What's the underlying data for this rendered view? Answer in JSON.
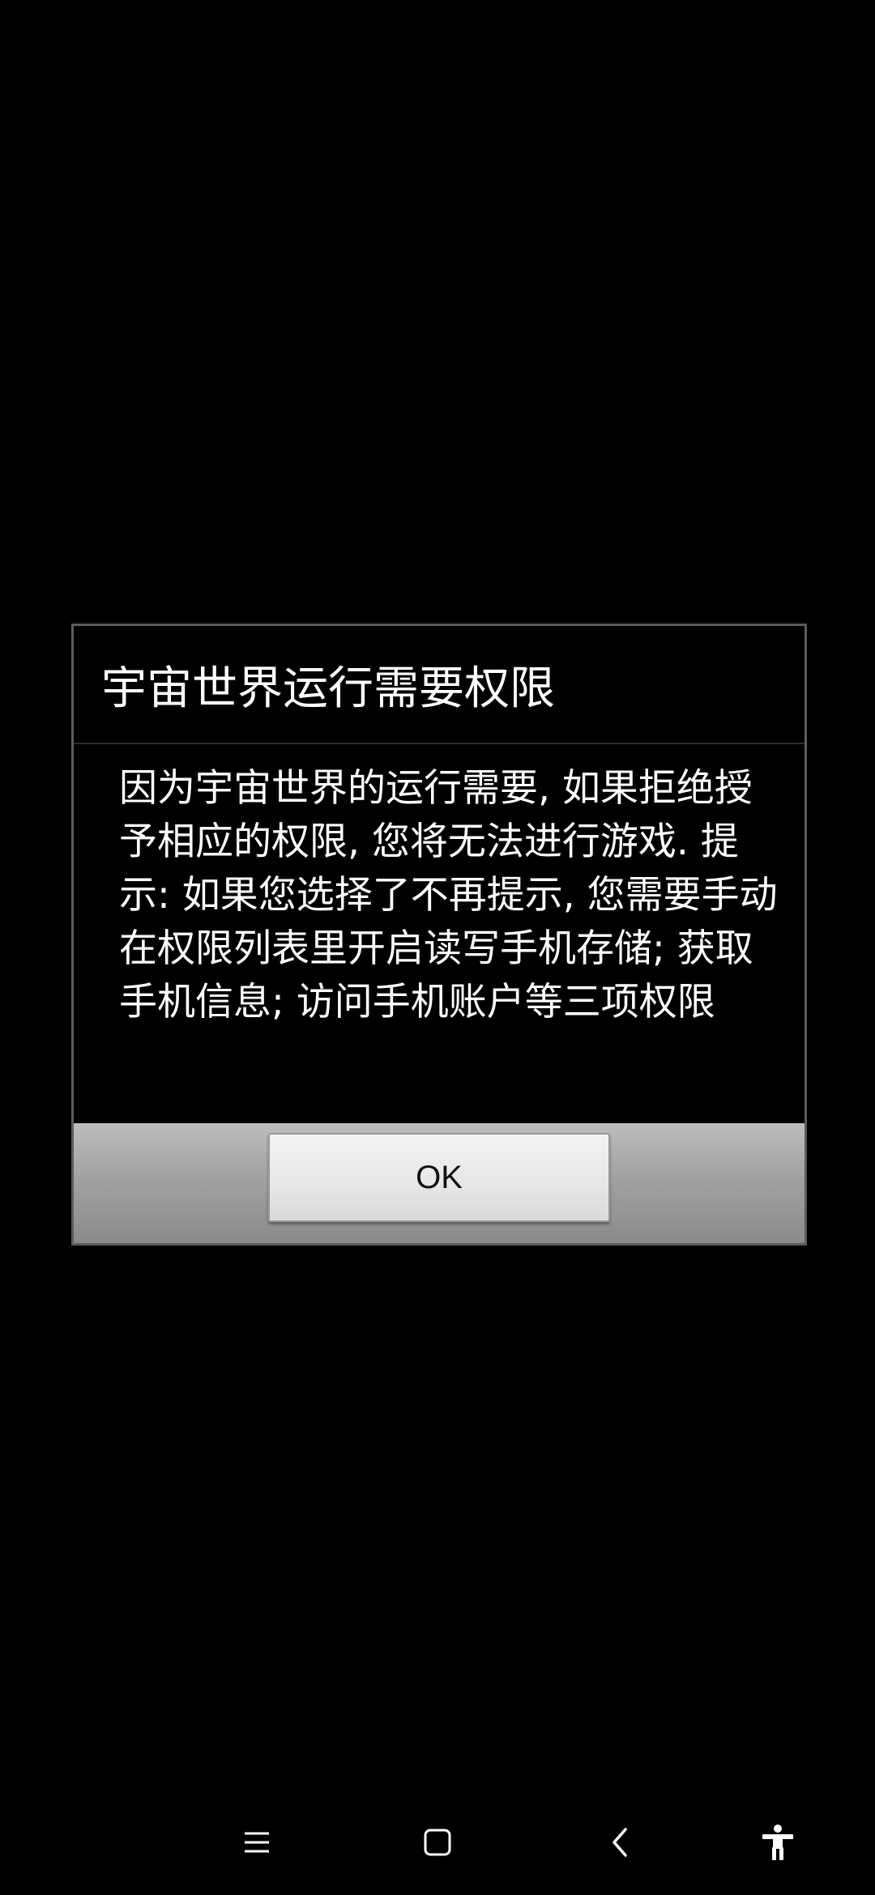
{
  "dialog": {
    "title": "宇宙世界运行需要权限",
    "message": "因为宇宙世界的运行需要, 如果拒绝授予相应的权限, 您将无法进行游戏. 提示: 如果您选择了不再提示, 您需要手动在权限列表里开启读写手机存储; 获取手机信息; 访问手机账户等三项权限",
    "ok_label": "OK"
  },
  "nav_bar": {
    "icons": [
      "menu-icon",
      "home-icon",
      "back-icon",
      "accessibility-icon"
    ]
  },
  "colors": {
    "background": "#000000",
    "text": "#ffffff",
    "dialog_border": "#5c5c5c",
    "button_bar": "#a2a2a2",
    "button_face": "#e6e6e6"
  }
}
